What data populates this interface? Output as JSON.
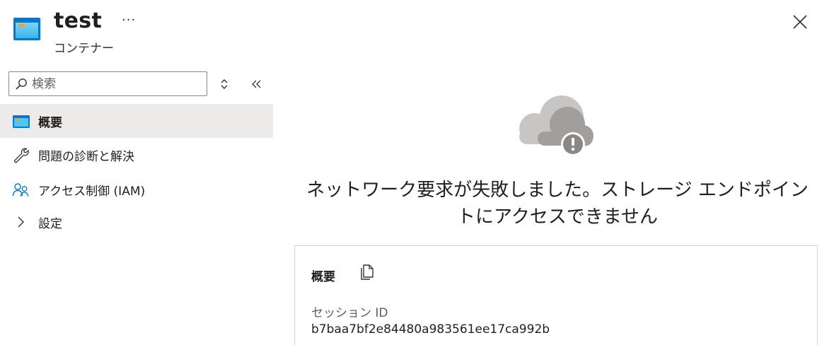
{
  "header": {
    "title": "test",
    "subtitle": "コンテナー",
    "more_label": "···"
  },
  "sidebar": {
    "search": {
      "placeholder": "検索",
      "value": ""
    },
    "items": [
      {
        "label": "概要",
        "icon": "container-icon",
        "active": true
      },
      {
        "label": "問題の診断と解決",
        "icon": "wrench-icon",
        "active": false
      },
      {
        "label": "アクセス制御 (IAM)",
        "icon": "people-icon",
        "active": false
      },
      {
        "label": "設定",
        "icon": "chevron-right-icon",
        "active": false
      }
    ]
  },
  "main": {
    "error_line1": "ネットワーク要求が失敗しました。ストレージ エンドポイン",
    "error_line2": "トにアクセスできません",
    "card": {
      "title": "概要",
      "session_label": "セッション ID",
      "session_value": "b7baa7bf2e84480a983561ee17ca992b"
    }
  },
  "colors": {
    "accent_blue": "#0078d4",
    "container_light_blue": "#50c7f0",
    "container_orange": "#f59e2a",
    "cloud_gray_light": "#c8c6c4",
    "cloud_gray_dark": "#a19f9d",
    "warning_badge": "#8a8886",
    "selected_bg": "#edebe9"
  }
}
